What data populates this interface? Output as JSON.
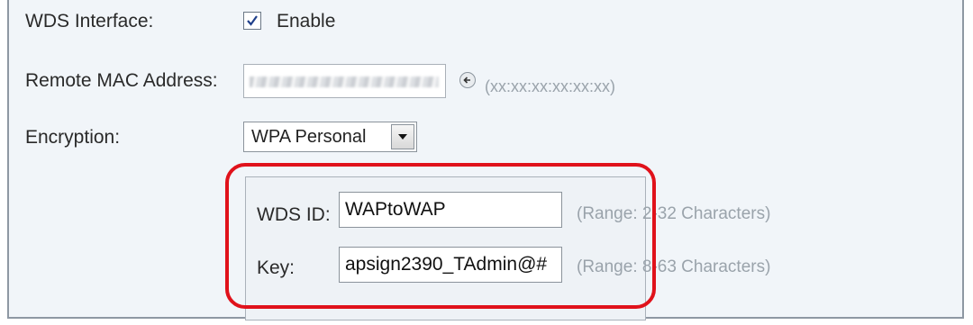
{
  "wds_interface": {
    "label": "WDS Interface:",
    "checkbox_checked": true,
    "checkbox_text": "Enable"
  },
  "remote_mac": {
    "label": "Remote MAC Address:",
    "value_obscured": true,
    "arrow_icon": "arrow-left-icon",
    "format_hint": "(xx:xx:xx:xx:xx:xx)"
  },
  "encryption": {
    "label": "Encryption:",
    "selected": "WPA Personal",
    "dropdown_icon": "chevron-down-icon"
  },
  "wds_id": {
    "label": "WDS ID:",
    "value": "WAPtoWAP",
    "range_hint": "(Range: 2-32 Characters)"
  },
  "key": {
    "label": "Key:",
    "value": "apsign2390_TAdmin@#",
    "range_hint": "(Range: 8-63 Characters)"
  },
  "colors": {
    "highlight": "#e0121b",
    "panel_bg": "#f1f5f9",
    "hint_text": "#9aa3ab"
  }
}
